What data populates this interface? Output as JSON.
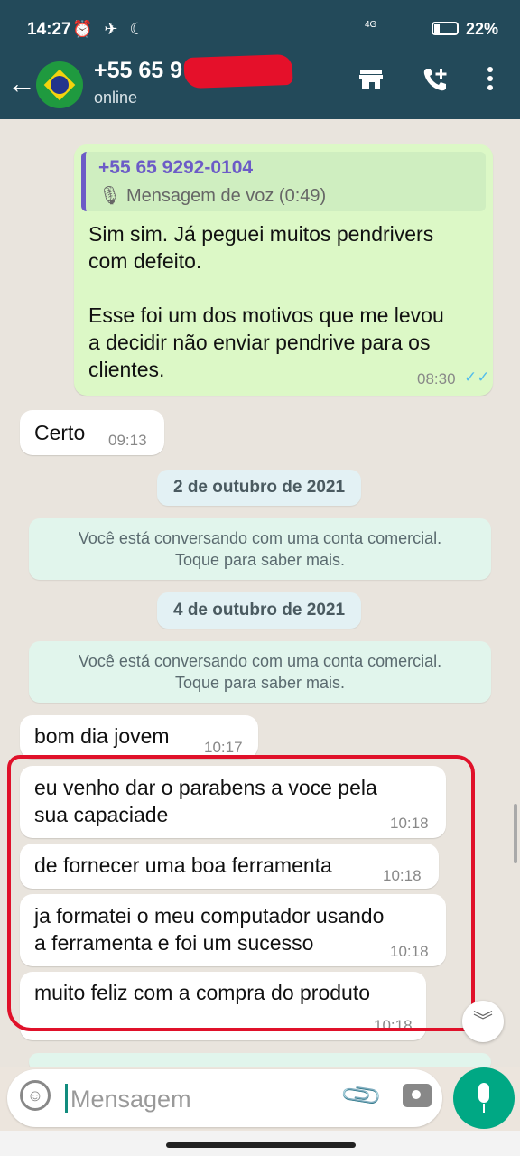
{
  "status_bar": {
    "time": "14:27",
    "icons": "⏰ ✈ ☾",
    "network": "4G",
    "battery_percent": "22%",
    "battery_level": 0.22
  },
  "header": {
    "contact_name": "+55 65 9",
    "status": "online"
  },
  "messages": [
    {
      "quote_name": "+55 65 9292-0104",
      "quote_text": "🎙 Mensagem de voz (0:49)",
      "text": "Sim sim. Já peguei muitos pendrivers\ncom defeito.\n\nEsse foi um dos motivos que me levou\na decidir não enviar pendrive para os\nclientes.",
      "time": "08:30",
      "ticks": "✓✓"
    },
    {
      "text": "Certo",
      "time": "09:13"
    },
    {
      "date": "2 de outubro de 2021"
    },
    {
      "system": "Você está conversando com uma conta comercial.\nToque para saber mais."
    },
    {
      "date": "4 de outubro de 2021"
    },
    {
      "system": "Você está conversando com uma conta comercial.\nToque para saber mais."
    },
    {
      "text": "bom dia jovem",
      "time": "10:17"
    },
    {
      "text": "eu venho dar o parabens a voce pela\nsua capaciade",
      "time": "10:18"
    },
    {
      "text": "de fornecer uma boa ferramenta",
      "time": "10:18"
    },
    {
      "text": "ja formatei o meu computador usando\na ferramenta e foi um sucesso",
      "time": "10:18"
    },
    {
      "text": "muito feliz com a compra do produto",
      "time": "10:18"
    }
  ],
  "input": {
    "placeholder": "Mensagem"
  },
  "colors": {
    "header": "#234a5a",
    "outgoing": "#dcf8c6",
    "accent": "#00a884",
    "highlight": "#e0112a"
  }
}
